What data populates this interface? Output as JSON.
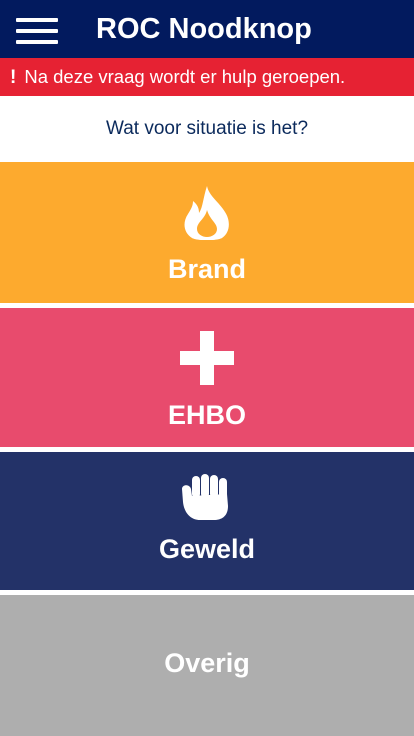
{
  "header": {
    "title": "ROC Noodknop",
    "menu_icon": "hamburger-menu-icon"
  },
  "alert": {
    "exclamation": "!",
    "text": "Na deze vraag wordt er hulp geroepen."
  },
  "question": "Wat voor situatie is het?",
  "options": [
    {
      "label": "Brand",
      "icon": "fire-icon",
      "color": "#fdaa2e"
    },
    {
      "label": "EHBO",
      "icon": "plus-icon",
      "color": "#e84b6d"
    },
    {
      "label": "Geweld",
      "icon": "fist-icon",
      "color": "#233268"
    },
    {
      "label": "Overig",
      "icon": "",
      "color": "#aeaeae"
    }
  ],
  "colors": {
    "header_bg": "#021a5e",
    "alert_bg": "#e62233",
    "question_text": "#0b2a5c"
  }
}
